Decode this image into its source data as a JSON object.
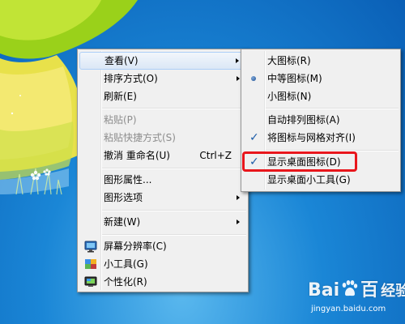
{
  "context_menu": {
    "items": [
      {
        "label": "查看(V)",
        "has_submenu": true,
        "state": "hover"
      },
      {
        "label": "排序方式(O)",
        "has_submenu": true
      },
      {
        "label": "刷新(E)"
      },
      {
        "label": "粘贴(P)",
        "disabled": true
      },
      {
        "label": "粘贴快捷方式(S)",
        "disabled": true
      },
      {
        "label": "撤消 重命名(U)",
        "shortcut": "Ctrl+Z"
      },
      {
        "label": "图形属性..."
      },
      {
        "label": "图形选项",
        "has_submenu": true
      },
      {
        "label": "新建(W)",
        "has_submenu": true
      },
      {
        "label": "屏幕分辨率(C)",
        "icon": "monitor-icon"
      },
      {
        "label": "小工具(G)",
        "icon": "gadgets-icon"
      },
      {
        "label": "个性化(R)",
        "icon": "personalize-icon"
      }
    ]
  },
  "view_submenu": {
    "items": [
      {
        "label": "大图标(R)"
      },
      {
        "label": "中等图标(M)",
        "selected": true
      },
      {
        "label": "小图标(N)"
      },
      {
        "label": "自动排列图标(A)"
      },
      {
        "label": "将图标与网格对齐(I)",
        "checked": true
      },
      {
        "label": "显示桌面图标(D)",
        "checked": true,
        "highlighted": true
      },
      {
        "label": "显示桌面小工具(G)"
      }
    ]
  },
  "glyphs": {
    "check": "✓"
  },
  "watermark": {
    "logo_left": "Bai",
    "logo_right": "百",
    "logo_suffix": "经验",
    "url": "jingyan.baidu.com"
  },
  "colors": {
    "highlight_box": "#e8161c",
    "menu_bg": "#f0f0f0"
  }
}
